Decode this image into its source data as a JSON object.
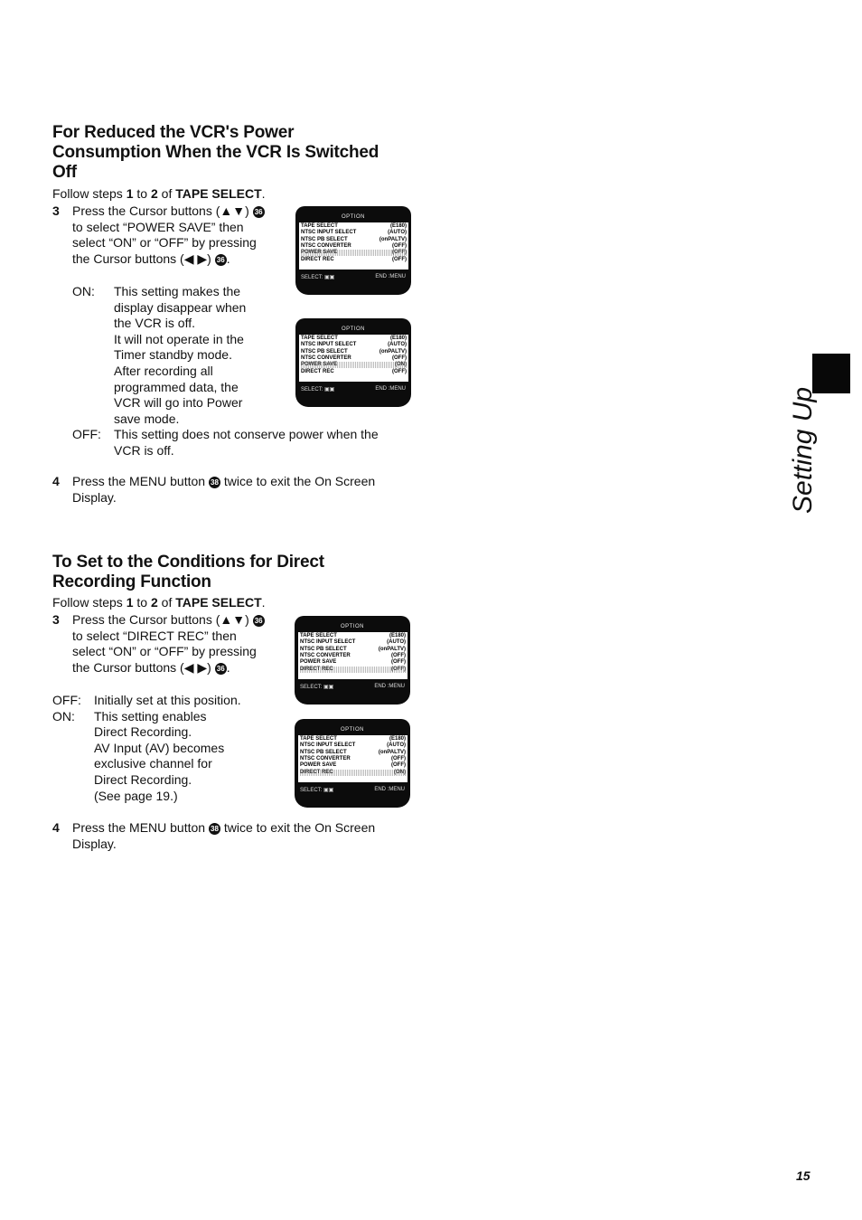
{
  "section1": {
    "heading": [
      "For Reduced the VCR's Power",
      "Consumption When the VCR Is Switched",
      "Off"
    ],
    "follow": {
      "pre": "Follow steps ",
      "a": "1",
      "mid": " to ",
      "b": "2",
      "of": " of ",
      "ref": "TAPE SELECT",
      "end": "."
    },
    "step3": {
      "num": "3",
      "lines": [
        "Press the Cursor buttons (▲▼)",
        "to select “POWER SAVE” then",
        "select “ON” or “OFF” by pressing",
        "the Cursor buttons (◀ ▶)"
      ],
      "button_ref": "36"
    },
    "on_label": "ON:",
    "on_lines": [
      "This setting makes the",
      "display disappear when",
      "the VCR is off.",
      "It will not operate in the",
      "Timer standby mode.",
      "After recording all",
      "programmed data, the",
      "VCR will go into Power",
      "save mode."
    ],
    "off_label": "OFF:",
    "off_lines": [
      "This setting does not conserve power when the",
      "VCR is off."
    ],
    "step4": {
      "num": "4",
      "pre": "Press the MENU button",
      "button_ref": "38",
      "post": "twice to exit the On Screen",
      "line2": "Display."
    }
  },
  "section2": {
    "heading": [
      "To Set to the Conditions for Direct",
      "Recording Function"
    ],
    "follow": {
      "pre": "Follow steps ",
      "a": "1",
      "mid": " to ",
      "b": "2",
      "of": " of ",
      "ref": "TAPE SELECT",
      "end": "."
    },
    "step3": {
      "num": "3",
      "lines": [
        "Press the Cursor buttons (▲▼)",
        "to select “DIRECT REC” then",
        "select “ON” or “OFF” by pressing",
        "the Cursor buttons (◀ ▶)"
      ],
      "button_ref": "36"
    },
    "off_label": "OFF:",
    "off_lines": [
      "Initially set at this position."
    ],
    "on_label": "ON:",
    "on_lines": [
      "This setting enables",
      "Direct Recording.",
      "AV Input (AV) becomes",
      "exclusive channel for",
      "Direct Recording.",
      "(See page 19.)"
    ],
    "step4": {
      "num": "4",
      "pre": "Press the MENU button",
      "button_ref": "38",
      "post": "twice to exit the On Screen",
      "line2": "Display."
    }
  },
  "screens": [
    {
      "title": "OPTION",
      "rows": [
        [
          "TAPE SELECT",
          "(E180)"
        ],
        [
          "NTSC INPUT SELECT",
          "(AUTO)"
        ],
        [
          "NTSC PB SELECT",
          "(onPALTV)"
        ],
        [
          "NTSC CONVERTER",
          "(OFF)"
        ],
        [
          "POWER SAVE",
          "(OFF)"
        ],
        [
          "DIRECT REC",
          "(OFF)"
        ]
      ],
      "highlight": 4,
      "footer_left": "SELECT: ▣▣",
      "footer_right": "END :MENU"
    },
    {
      "title": "OPTION",
      "rows": [
        [
          "TAPE SELECT",
          "(E180)"
        ],
        [
          "NTSC INPUT SELECT",
          "(AUTO)"
        ],
        [
          "NTSC PB SELECT",
          "(onPALTV)"
        ],
        [
          "NTSC CONVERTER",
          "(OFF)"
        ],
        [
          "POWER SAVE",
          "(ON)"
        ],
        [
          "DIRECT REC",
          "(OFF)"
        ]
      ],
      "highlight": 4,
      "footer_left": "SELECT: ▣▣",
      "footer_right": "END :MENU"
    },
    {
      "title": "OPTION",
      "rows": [
        [
          "TAPE SELECT",
          "(E180)"
        ],
        [
          "NTSC INPUT SELECT",
          "(AUTO)"
        ],
        [
          "NTSC PB SELECT",
          "(onPALTV)"
        ],
        [
          "NTSC CONVERTER",
          "(OFF)"
        ],
        [
          "POWER SAVE",
          "(OFF)"
        ],
        [
          "DIRECT REC",
          "(OFF)"
        ]
      ],
      "highlight": 5,
      "footer_left": "SELECT: ▣▣",
      "footer_right": "END :MENU"
    },
    {
      "title": "OPTION",
      "rows": [
        [
          "TAPE SELECT",
          "(E180)"
        ],
        [
          "NTSC INPUT SELECT",
          "(AUTO)"
        ],
        [
          "NTSC PB SELECT",
          "(onPALTV)"
        ],
        [
          "NTSC CONVERTER",
          "(OFF)"
        ],
        [
          "POWER SAVE",
          "(OFF)"
        ],
        [
          "DIRECT REC",
          "(ON)"
        ]
      ],
      "highlight": 5,
      "footer_left": "SELECT: ▣▣",
      "footer_right": "END :MENU"
    }
  ],
  "side_tab": "Setting Up",
  "page_number": "15"
}
